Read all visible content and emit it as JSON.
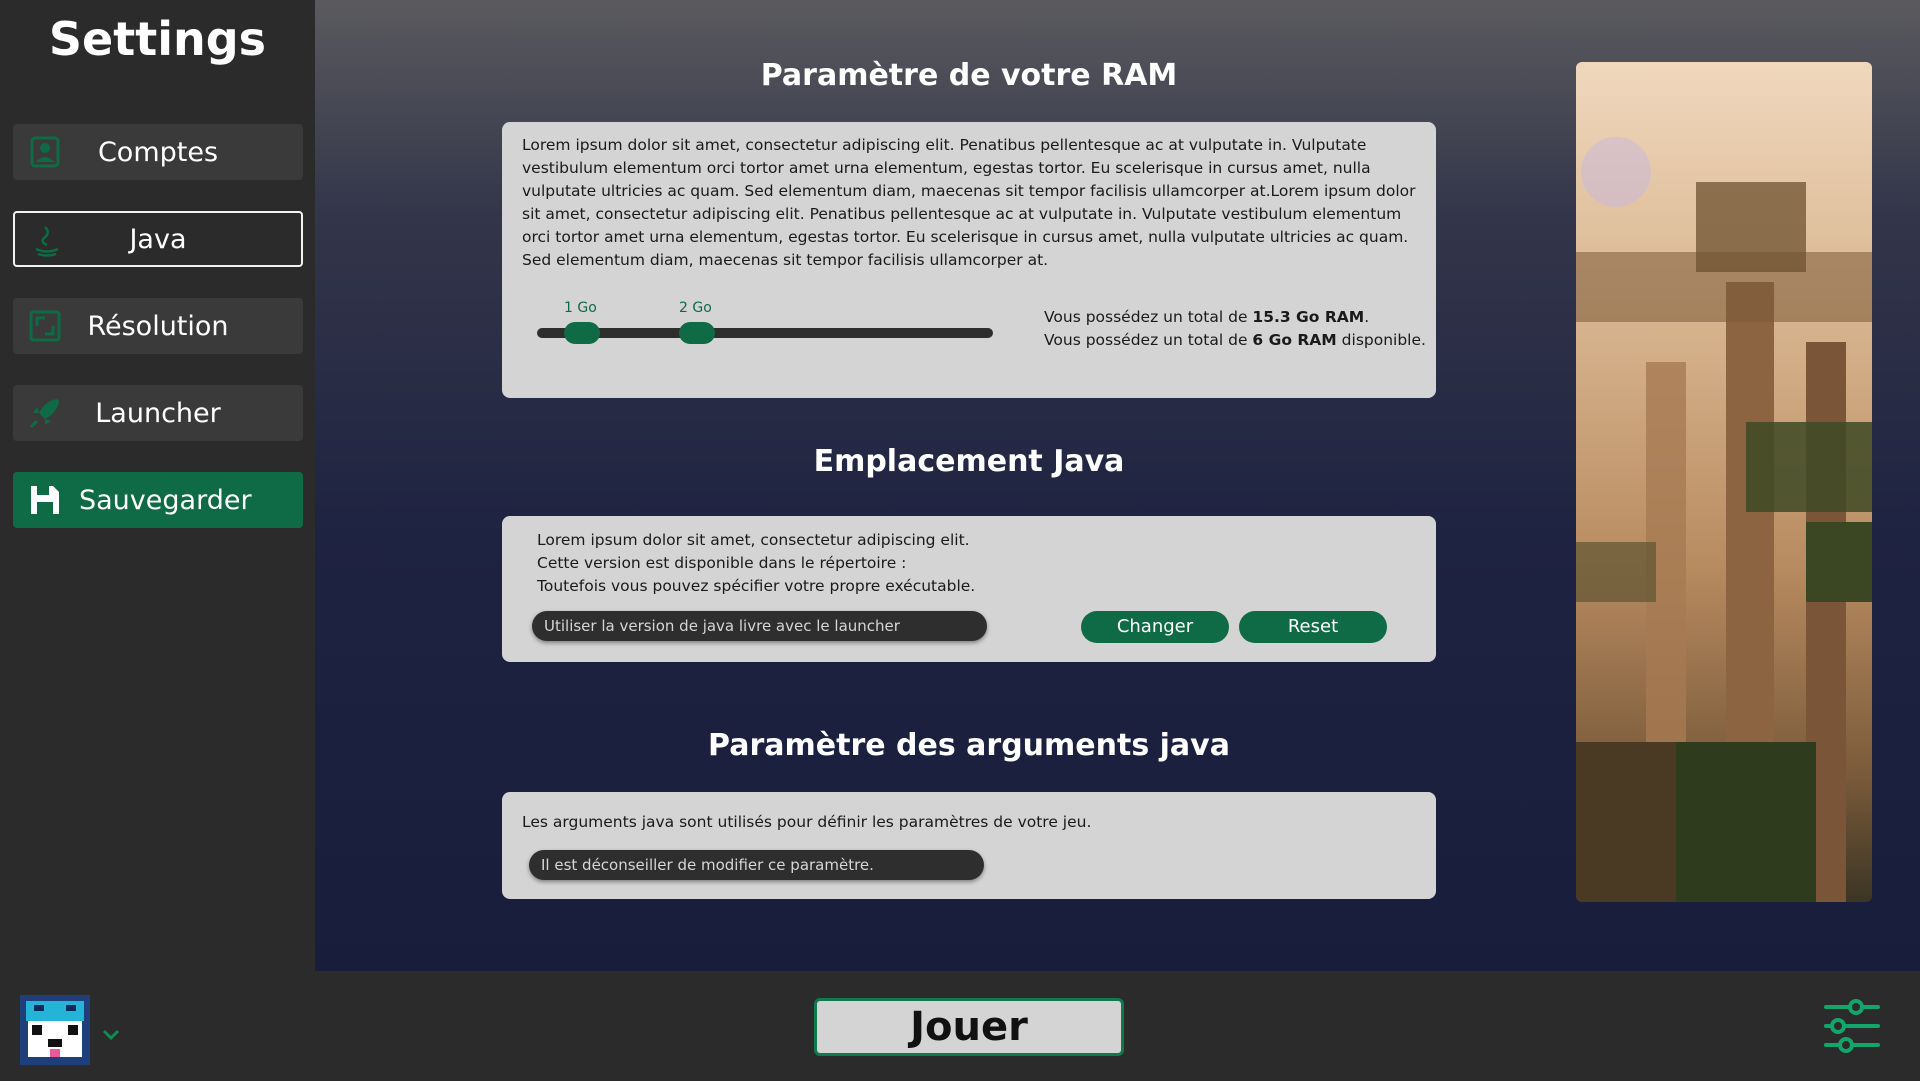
{
  "sidebar": {
    "title": "Settings",
    "items": [
      {
        "label": "Comptes",
        "icon": "account-icon"
      },
      {
        "label": "Java",
        "icon": "java-icon"
      },
      {
        "label": "Résolution",
        "icon": "resolution-icon"
      },
      {
        "label": "Launcher",
        "icon": "rocket-icon"
      }
    ],
    "save_label": "Sauvegarder"
  },
  "ram": {
    "title": "Paramètre de votre RAM",
    "description": "Lorem ipsum dolor sit amet, consectetur adipiscing elit. Penatibus pellentesque ac at vulputate in. Vulputate vestibulum elementum orci tortor amet urna elementum, egestas tortor. Eu scelerisque in cursus amet, nulla vulputate ultricies ac quam. Sed elementum diam, maecenas sit tempor facilisis ullamcorper at.Lorem ipsum dolor sit amet, consectetur adipiscing elit. Penatibus pellentesque ac at vulputate in. Vulputate vestibulum elementum orci tortor amet urna elementum, egestas tortor. Eu scelerisque in cursus amet, nulla vulputate ultricies ac quam. Sed elementum diam, maecenas sit tempor facilisis ullamcorper at.",
    "min_label": "1 Go",
    "max_label": "2 Go",
    "total_prefix": "Vous possédez un total de",
    "total_value": "15.3 Go RAM",
    "available_prefix": "Vous possédez un total de",
    "available_value": "6 Go RAM",
    "available_suffix": "disponible."
  },
  "java": {
    "title": "Emplacement Java",
    "line1": "Lorem ipsum dolor sit amet, consectetur adipiscing elit.",
    "line2": "Cette version est disponible dans le répertoire :",
    "line3": "Toutefois vous pouvez spécifier votre propre exécutable.",
    "path_value": "Utiliser la version de java livre avec le launcher",
    "change_label": "Changer",
    "reset_label": "Reset"
  },
  "args": {
    "title": "Paramètre des arguments java",
    "description": "Les arguments java sont utilisés pour définir les paramètres de votre jeu.",
    "input_value": "Il est déconseiller de modifier ce paramètre."
  },
  "bottom": {
    "play_label": "Jouer"
  },
  "colors": {
    "accent": "#0e6b45",
    "sidebar_bg": "#2b2b2b",
    "card_bg": "#d4d4d4"
  }
}
